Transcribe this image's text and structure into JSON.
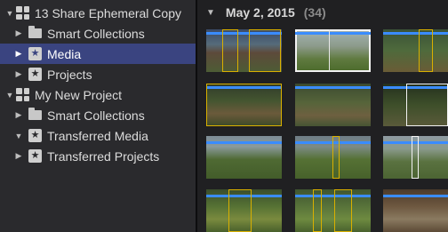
{
  "sidebar": {
    "items": [
      {
        "label": "13 Share Ephemeral Copy",
        "icon": "library-icon",
        "expanded": true,
        "indent": 0
      },
      {
        "label": "Smart Collections",
        "icon": "folder-icon",
        "expanded": false,
        "indent": 1
      },
      {
        "label": "Media",
        "icon": "star-event-icon",
        "expanded": false,
        "indent": 1,
        "selected": true
      },
      {
        "label": "Projects",
        "icon": "star-event-icon",
        "expanded": false,
        "indent": 1
      },
      {
        "label": "My New Project",
        "icon": "library-icon",
        "expanded": true,
        "indent": 0
      },
      {
        "label": "Smart Collections",
        "icon": "folder-icon",
        "expanded": false,
        "indent": 1
      },
      {
        "label": "Transferred Media",
        "icon": "star-event-icon",
        "expanded": true,
        "indent": 1
      },
      {
        "label": "Transferred Projects",
        "icon": "star-event-icon",
        "expanded": false,
        "indent": 1
      }
    ]
  },
  "browser": {
    "date_label": "May 2, 2015",
    "count": "(34)"
  },
  "colors": {
    "accent": "#3a4480",
    "clip_bar": "#3a8cff",
    "selection_yellow": "#d9b000"
  }
}
